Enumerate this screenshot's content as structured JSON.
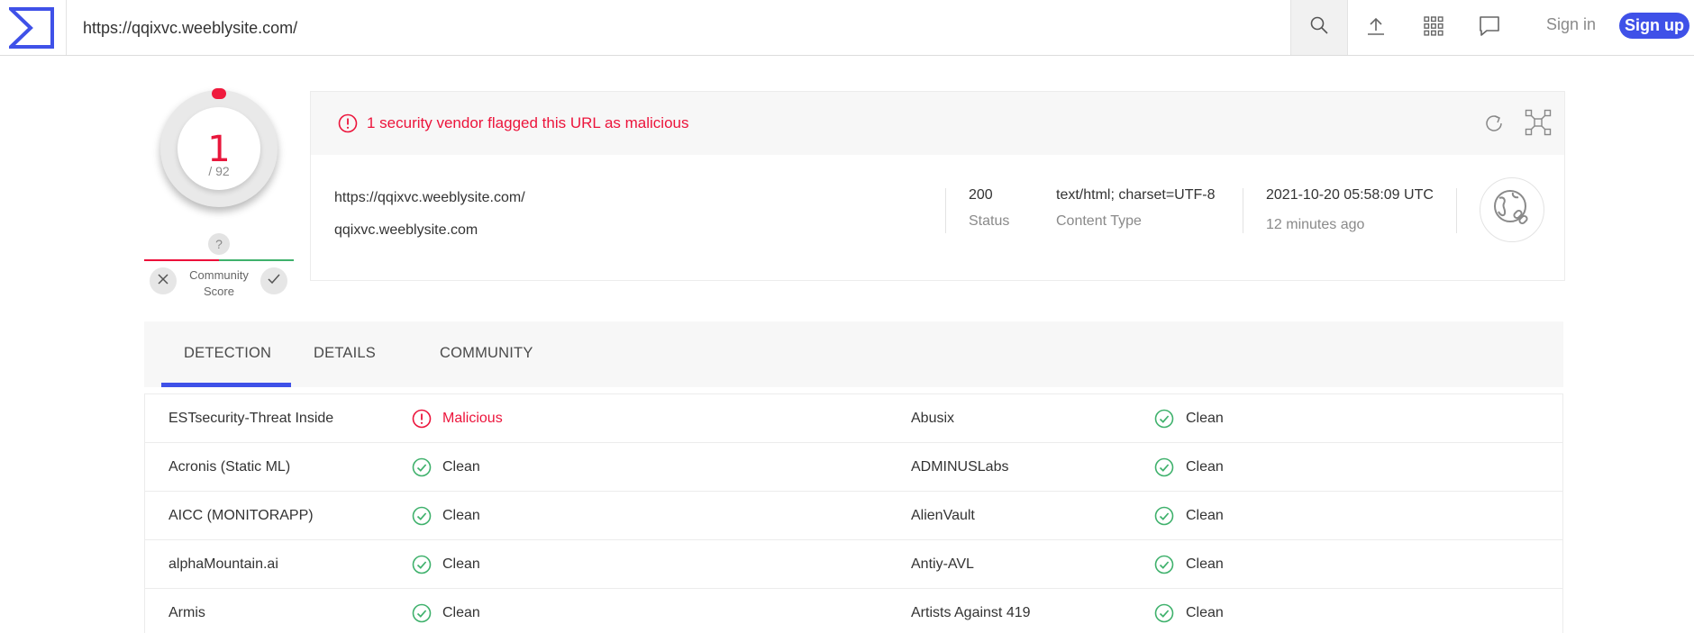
{
  "header": {
    "logo": "virustotal-logo",
    "url_value": "https://qqixvc.weeblysite.com/",
    "icons": [
      "search-icon",
      "upload-icon",
      "apps-grid-icon",
      "chat-icon"
    ],
    "sign_in": "Sign in",
    "sign_up": "Sign up"
  },
  "score": {
    "detections": "1",
    "total": "/ 92",
    "community_unknown": "?",
    "community_label_1": "Community",
    "community_label_2": "Score"
  },
  "summary": {
    "alert": "1 security vendor flagged this URL as malicious",
    "url": "https://qqixvc.weeblysite.com/",
    "domain": "qqixvc.weeblysite.com",
    "status_value": "200",
    "status_label": "Status",
    "content_type_value": "text/html; charset=UTF-8",
    "content_type_label": "Content Type",
    "date_value": "2021-10-20 05:58:09 UTC",
    "date_ago": "12 minutes ago"
  },
  "tabs": [
    {
      "label": "DETECTION",
      "active": true
    },
    {
      "label": "DETAILS",
      "active": false
    },
    {
      "label": "COMMUNITY",
      "active": false
    }
  ],
  "detections": [
    {
      "left": {
        "vendor": "ESTsecurity-Threat Inside",
        "result": "Malicious",
        "status": "malicious"
      },
      "right": {
        "vendor": "Abusix",
        "result": "Clean",
        "status": "clean"
      }
    },
    {
      "left": {
        "vendor": "Acronis (Static ML)",
        "result": "Clean",
        "status": "clean"
      },
      "right": {
        "vendor": "ADMINUSLabs",
        "result": "Clean",
        "status": "clean"
      }
    },
    {
      "left": {
        "vendor": "AICC (MONITORAPP)",
        "result": "Clean",
        "status": "clean"
      },
      "right": {
        "vendor": "AlienVault",
        "result": "Clean",
        "status": "clean"
      }
    },
    {
      "left": {
        "vendor": "alphaMountain.ai",
        "result": "Clean",
        "status": "clean"
      },
      "right": {
        "vendor": "Antiy-AVL",
        "result": "Clean",
        "status": "clean"
      }
    },
    {
      "left": {
        "vendor": "Armis",
        "result": "Clean",
        "status": "clean"
      },
      "right": {
        "vendor": "Artists Against 419",
        "result": "Clean",
        "status": "clean"
      }
    }
  ],
  "colors": {
    "accent": "#3f51e8",
    "malicious": "#ec143b",
    "clean": "#3fb16c"
  }
}
